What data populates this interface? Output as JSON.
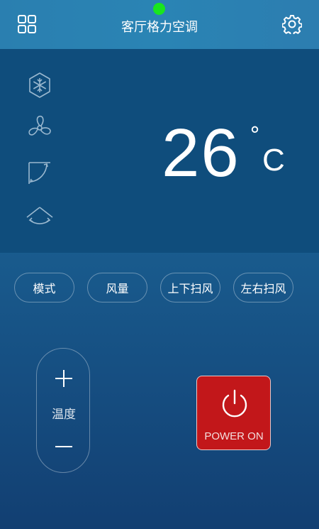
{
  "header": {
    "title": "客厅格力空调",
    "menu_icon": "grid-icon",
    "settings_icon": "gear-icon",
    "status_color": "#19e61e"
  },
  "display": {
    "mode_icons": [
      "snowflake-icon",
      "fan-icon",
      "vertical-swing-icon",
      "horizontal-swing-icon"
    ],
    "temperature": "26",
    "unit_degree": "°",
    "unit_letter": "C"
  },
  "functions": {
    "mode": "模式",
    "fan_speed": "风量",
    "vertical_swing": "上下扫风",
    "horizontal_swing": "左右扫风"
  },
  "temp_control": {
    "label": "温度",
    "increase_icon": "plus-icon",
    "decrease_icon": "minus-icon"
  },
  "power": {
    "label": "POWER ON",
    "color": "#c2171a"
  }
}
